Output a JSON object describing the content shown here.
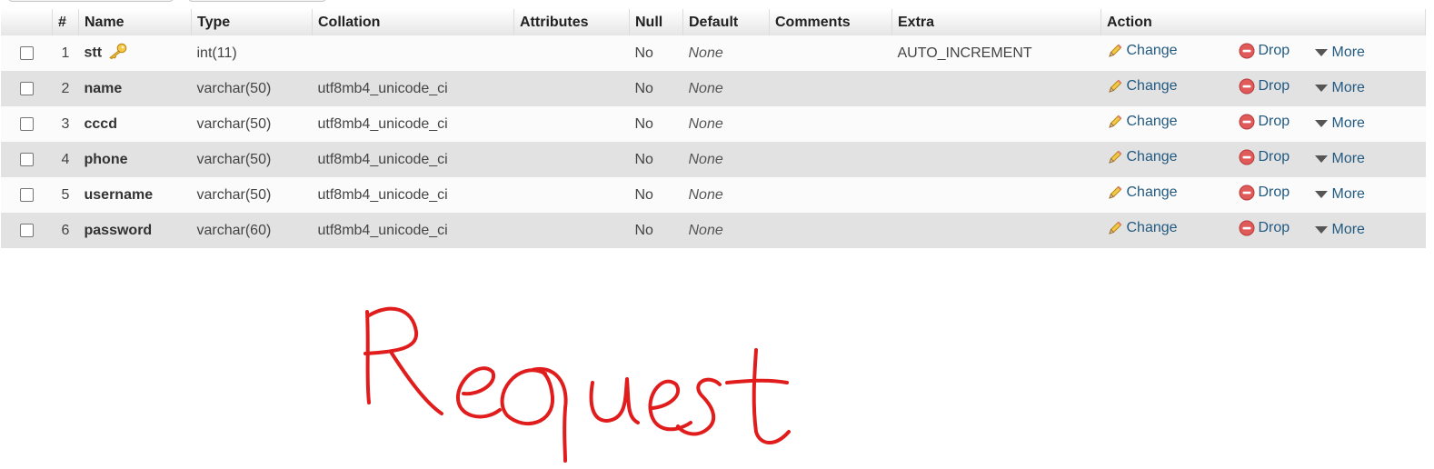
{
  "columns": {
    "num": "#",
    "name": "Name",
    "type": "Type",
    "collation": "Collation",
    "attributes": "Attributes",
    "null": "Null",
    "default": "Default",
    "comments": "Comments",
    "extra": "Extra",
    "action": "Action"
  },
  "actions": {
    "change": "Change",
    "drop": "Drop",
    "more": "More"
  },
  "rows": [
    {
      "num": "1",
      "name": "stt",
      "type": "int(11)",
      "collation": "",
      "attributes": "",
      "null": "No",
      "default": "None",
      "comments": "",
      "extra": "AUTO_INCREMENT",
      "primary_key": true
    },
    {
      "num": "2",
      "name": "name",
      "type": "varchar(50)",
      "collation": "utf8mb4_unicode_ci",
      "attributes": "",
      "null": "No",
      "default": "None",
      "comments": "",
      "extra": ""
    },
    {
      "num": "3",
      "name": "cccd",
      "type": "varchar(50)",
      "collation": "utf8mb4_unicode_ci",
      "attributes": "",
      "null": "No",
      "default": "None",
      "comments": "",
      "extra": ""
    },
    {
      "num": "4",
      "name": "phone",
      "type": "varchar(50)",
      "collation": "utf8mb4_unicode_ci",
      "attributes": "",
      "null": "No",
      "default": "None",
      "comments": "",
      "extra": ""
    },
    {
      "num": "5",
      "name": "username",
      "type": "varchar(50)",
      "collation": "utf8mb4_unicode_ci",
      "attributes": "",
      "null": "No",
      "default": "None",
      "comments": "",
      "extra": ""
    },
    {
      "num": "6",
      "name": "password",
      "type": "varchar(60)",
      "collation": "utf8mb4_unicode_ci",
      "attributes": "",
      "null": "No",
      "default": "None",
      "comments": "",
      "extra": ""
    }
  ],
  "annotation": {
    "text": "Request",
    "color": "#e01c1c"
  },
  "colors": {
    "link": "#235a81",
    "row_even": "#e2e2e2",
    "row_odd": "#fbfbfb",
    "drop_icon": "#e05a5a"
  },
  "icons": {
    "primary_key": "key-icon",
    "change": "pencil-icon",
    "drop": "drop-icon",
    "more": "triangle-down-icon"
  }
}
